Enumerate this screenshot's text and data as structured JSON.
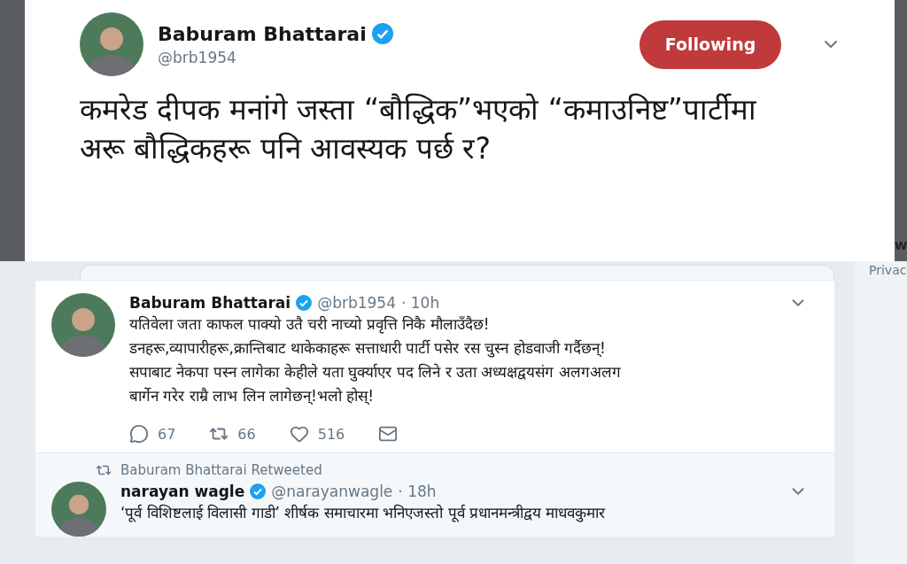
{
  "focused_tweet": {
    "name": "Baburam Bhattarai",
    "verified": true,
    "handle": "@brb1954",
    "follow_button": "Following",
    "text": "कमरेड दीपक मनांगे जस्ता “बौद्धिक”भएको “कमाउनिष्ट”पार्टीमा अरू बौद्धिकहरू पनि आवस्यक पर्छ र?"
  },
  "side_texts": [
    "W",
    "Privac"
  ],
  "timeline": [
    {
      "name": "Baburam Bhattarai",
      "verified": true,
      "handle": "@brb1954",
      "time": "· 10h",
      "lines": [
        "यतिवेला जता काफल पाक्यो उतै चरी नाच्यो प्रवृत्ति निकै मौलाउँदैछ!",
        "डनहरू,व्यापारीहरू,क्रान्तिबाट थाकेकाहरू सत्ताधारी पार्टी पसेर रस चुस्न होडवाजी गर्दैछन्!",
        "सपाबाट नेकपा पस्न लागेका केहीले यता घुर्क्याएर पद लिने र उता अध्यक्षद्वयसंग अलगअलग",
        "बार्गेन गरेर राम्रै लाभ लिन लागेछन्!भलो होस्!"
      ],
      "actions": [
        {
          "kind": "reply",
          "count": "67"
        },
        {
          "kind": "retweet",
          "count": "66"
        },
        {
          "kind": "like",
          "count": "516"
        },
        {
          "kind": "message"
        }
      ]
    },
    {
      "retweeted_by": "Baburam Bhattarai Retweeted",
      "name": "narayan wagle",
      "verified": true,
      "handle": "@narayanwagle",
      "time": "· 18h",
      "lines": [
        "‘पूर्व विशिष्टलाई विलासी गाडी’ शीर्षक समाचारमा भनिएजस्तो पूर्व प्रधानमन्त्रीद्वय माधवकुमार"
      ]
    }
  ]
}
